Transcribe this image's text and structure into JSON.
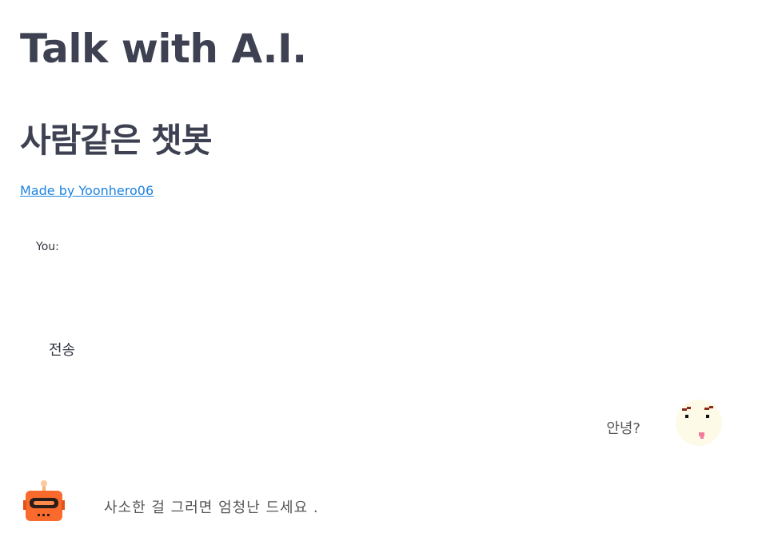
{
  "header": {
    "title": "Talk with A.I.",
    "subtitle": "사람같은 챗봇",
    "credit_link": "Made by Yoonhero06"
  },
  "form": {
    "input_label": "You:",
    "input_value": "",
    "send_button": "전송"
  },
  "chat": {
    "messages": [
      {
        "role": "user",
        "text": "안녕?",
        "avatar": "pixel-face-icon"
      },
      {
        "role": "bot",
        "text": "사소한 걸 그러면 엄청난 드세요 .",
        "avatar": "robot-icon"
      }
    ]
  },
  "colors": {
    "link": "#1c83e1",
    "heading": "#3d4151",
    "bot_avatar": "#f96a2c",
    "user_avatar_bg": "#fdfbe8"
  }
}
